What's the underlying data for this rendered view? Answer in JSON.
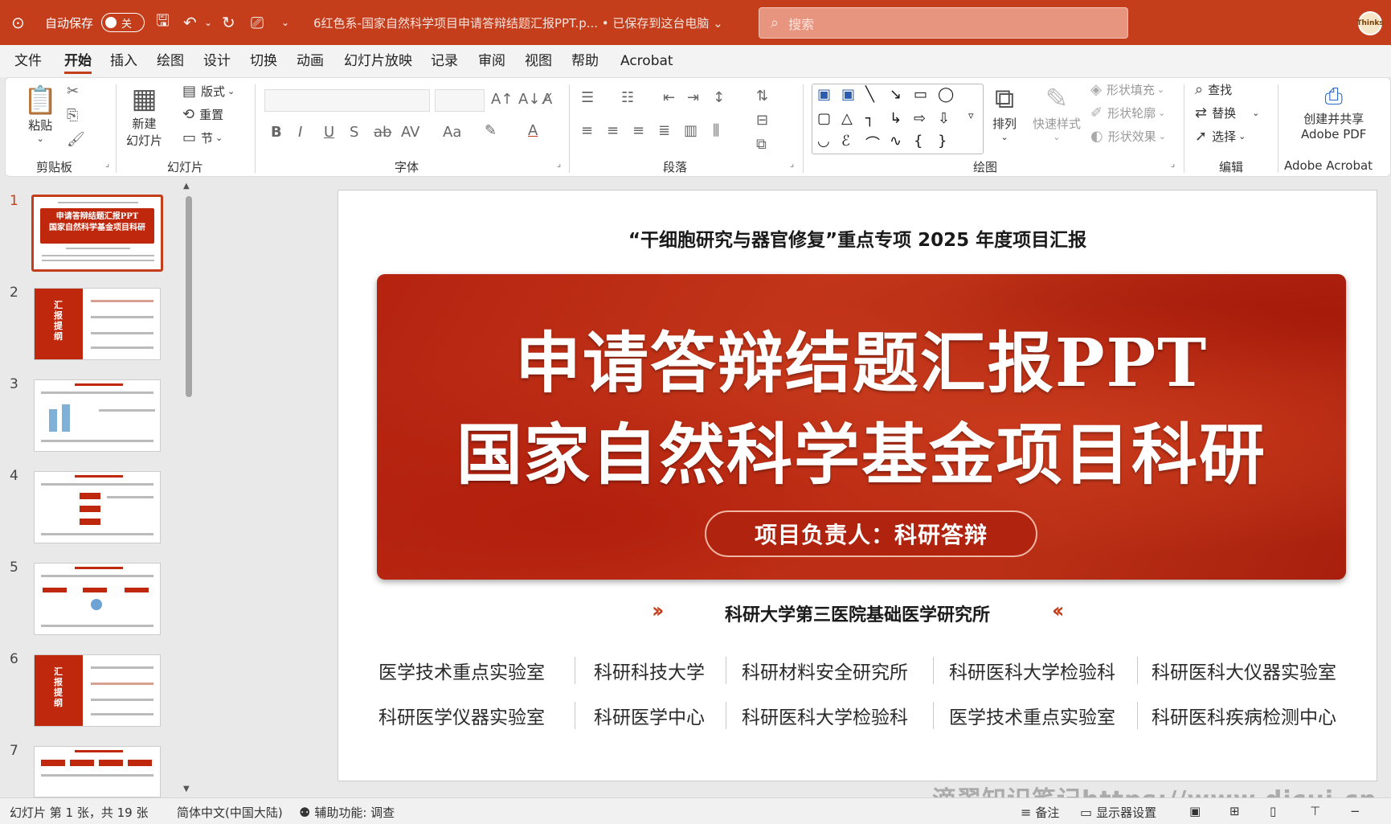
{
  "titlebar": {
    "autosave_label": "自动保存",
    "autosave_state": "关",
    "doc_title": "6红色系-国家自然科学项目申请答辩结题汇报PPT.p...  •  已保存到这台电脑 ⌄",
    "search_placeholder": "搜索",
    "avatar_text": "Thinks",
    "accent_color": "#c43e1c"
  },
  "menu": {
    "tabs": [
      "文件",
      "开始",
      "插入",
      "绘图",
      "设计",
      "切换",
      "动画",
      "幻灯片放映",
      "记录",
      "审阅",
      "视图",
      "帮助",
      "Acrobat"
    ],
    "active": "开始"
  },
  "ribbon": {
    "clipboard": {
      "paste": "粘贴",
      "label": "剪贴板"
    },
    "slides": {
      "new_slide_1": "新建",
      "new_slide_2": "幻灯片",
      "layout": "版式",
      "reset": "重置",
      "section": "节",
      "label": "幻灯片"
    },
    "font": {
      "label": "字体",
      "bold": "B",
      "italic": "I",
      "underline": "U",
      "shadow": "S",
      "strike": "ab",
      "spacing": "AV",
      "case": "Aa",
      "color": "A"
    },
    "paragraph": {
      "label": "段落"
    },
    "drawing": {
      "arrange": "排列",
      "quick_styles": "快速样式",
      "shape_fill": "形状填充",
      "shape_outline": "形状轮廓",
      "shape_effects": "形状效果",
      "label": "绘图"
    },
    "editing": {
      "find": "查找",
      "replace": "替换",
      "select": "选择",
      "label": "编辑"
    },
    "acrobat": {
      "create_1": "创建并共享",
      "create_2": "Adobe PDF",
      "label": "Adobe Acrobat"
    }
  },
  "thumbnails": {
    "numbers": [
      "1",
      "2",
      "3",
      "4",
      "5",
      "6",
      "7"
    ],
    "selected": 1,
    "t1_line1": "申请答辩结题汇报PPT",
    "t1_line2": "国家自然科学基金项目科研",
    "t2_vert": "汇报提纲",
    "t6_vert": "汇报提纲"
  },
  "slide": {
    "subtitle": "“干细胞研究与器官修复”重点专项 2025 年度项目汇报",
    "title_line1": "申请答辩结题汇报PPT",
    "title_line2": "国家自然科学基金项目科研",
    "leader": "项目负责人：科研答辩",
    "institute": "科研大学第三医院基础医学研究所",
    "units_row1": [
      "医学技术重点实验室",
      "科研科技大学",
      "科研材料安全研究所",
      "科研医科大学检验科",
      "科研医科大仪器实验室"
    ],
    "units_row2": [
      "科研医学仪器实验室",
      "科研医学中心",
      "科研医科大学检验科",
      "医学技术重点实验室",
      "科研医科疾病检测中心"
    ]
  },
  "statusbar": {
    "slide_info": "幻灯片 第 1 张，共 19 张",
    "language": "简体中文(中国大陆)",
    "accessibility": "辅助功能: 调查",
    "notes": "备注",
    "display": "显示器设置"
  },
  "watermark": "滴翠知识笔记https://www.dicui.cn"
}
